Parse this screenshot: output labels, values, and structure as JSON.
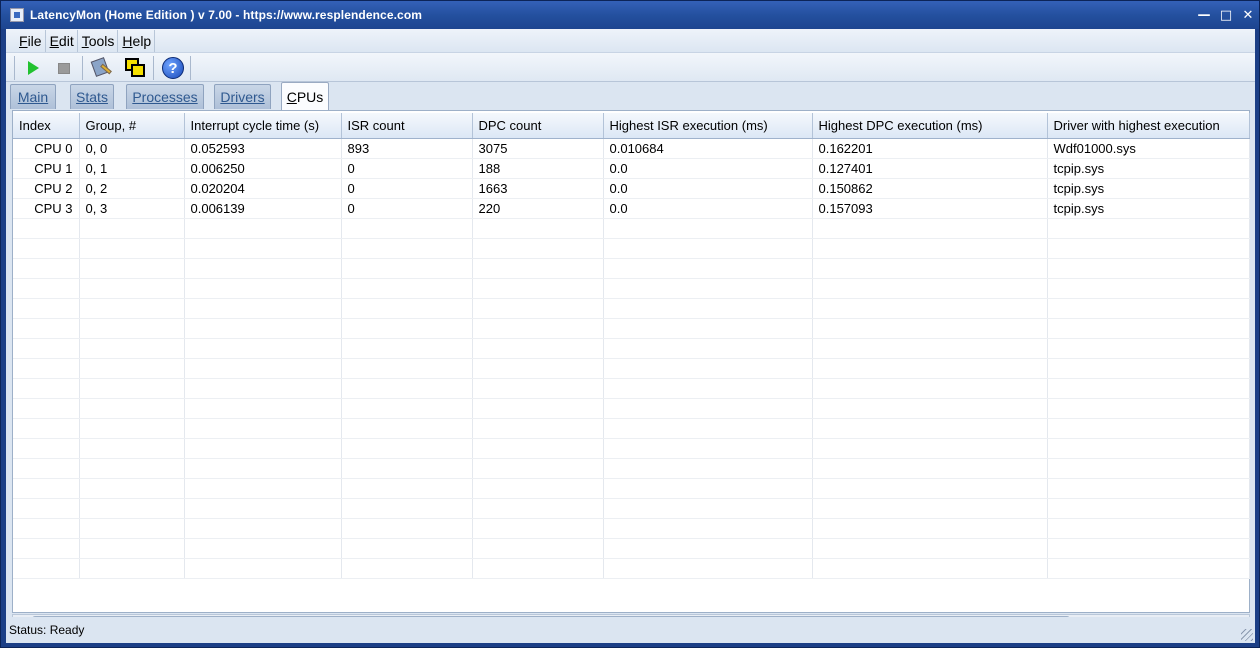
{
  "window": {
    "title": "LatencyMon  (Home Edition )  v 7.00 - https://www.resplendence.com",
    "minimize": "—",
    "maximize": "□",
    "close": "✕"
  },
  "menu": [
    "File",
    "Edit",
    "Tools",
    "Help"
  ],
  "toolbar": {
    "start_icon": "play-icon",
    "stop_icon": "stop-icon",
    "tools_icon": "tools-icon",
    "windows_icon": "windows-icon",
    "help_icon": "help-icon",
    "help_glyph": "?"
  },
  "tabs": {
    "main": "Main",
    "stats": "Stats",
    "processes": "Processes",
    "drivers": "Drivers",
    "cpus_prefix": "C",
    "cpus_rest": "PUs"
  },
  "grid": {
    "columns": [
      "Index",
      "Group, #",
      "Interrupt cycle time (s)",
      "ISR count",
      "DPC count",
      "Highest ISR execution (ms)",
      "Highest DPC execution (ms)",
      "Driver with highest execution"
    ],
    "rows": [
      [
        "CPU 0",
        "0, 0",
        "0.052593",
        "893",
        "3075",
        "0.010684",
        "0.162201",
        "Wdf01000.sys"
      ],
      [
        "CPU 1",
        "0, 1",
        "0.006250",
        "0",
        "188",
        "0.0",
        "0.127401",
        "tcpip.sys"
      ],
      [
        "CPU 2",
        "0, 2",
        "0.020204",
        "0",
        "1663",
        "0.0",
        "0.150862",
        "tcpip.sys"
      ],
      [
        "CPU 3",
        "0, 3",
        "0.006139",
        "0",
        "220",
        "0.0",
        "0.157093",
        "tcpip.sys"
      ]
    ]
  },
  "scrollbar": {
    "left_arrow": "◀",
    "right_arrow": "▶"
  },
  "status": {
    "text": "Status: Ready"
  },
  "colors": {
    "titlebar": "#24509f",
    "client": "#dbe5f1",
    "play": "#22c230"
  }
}
